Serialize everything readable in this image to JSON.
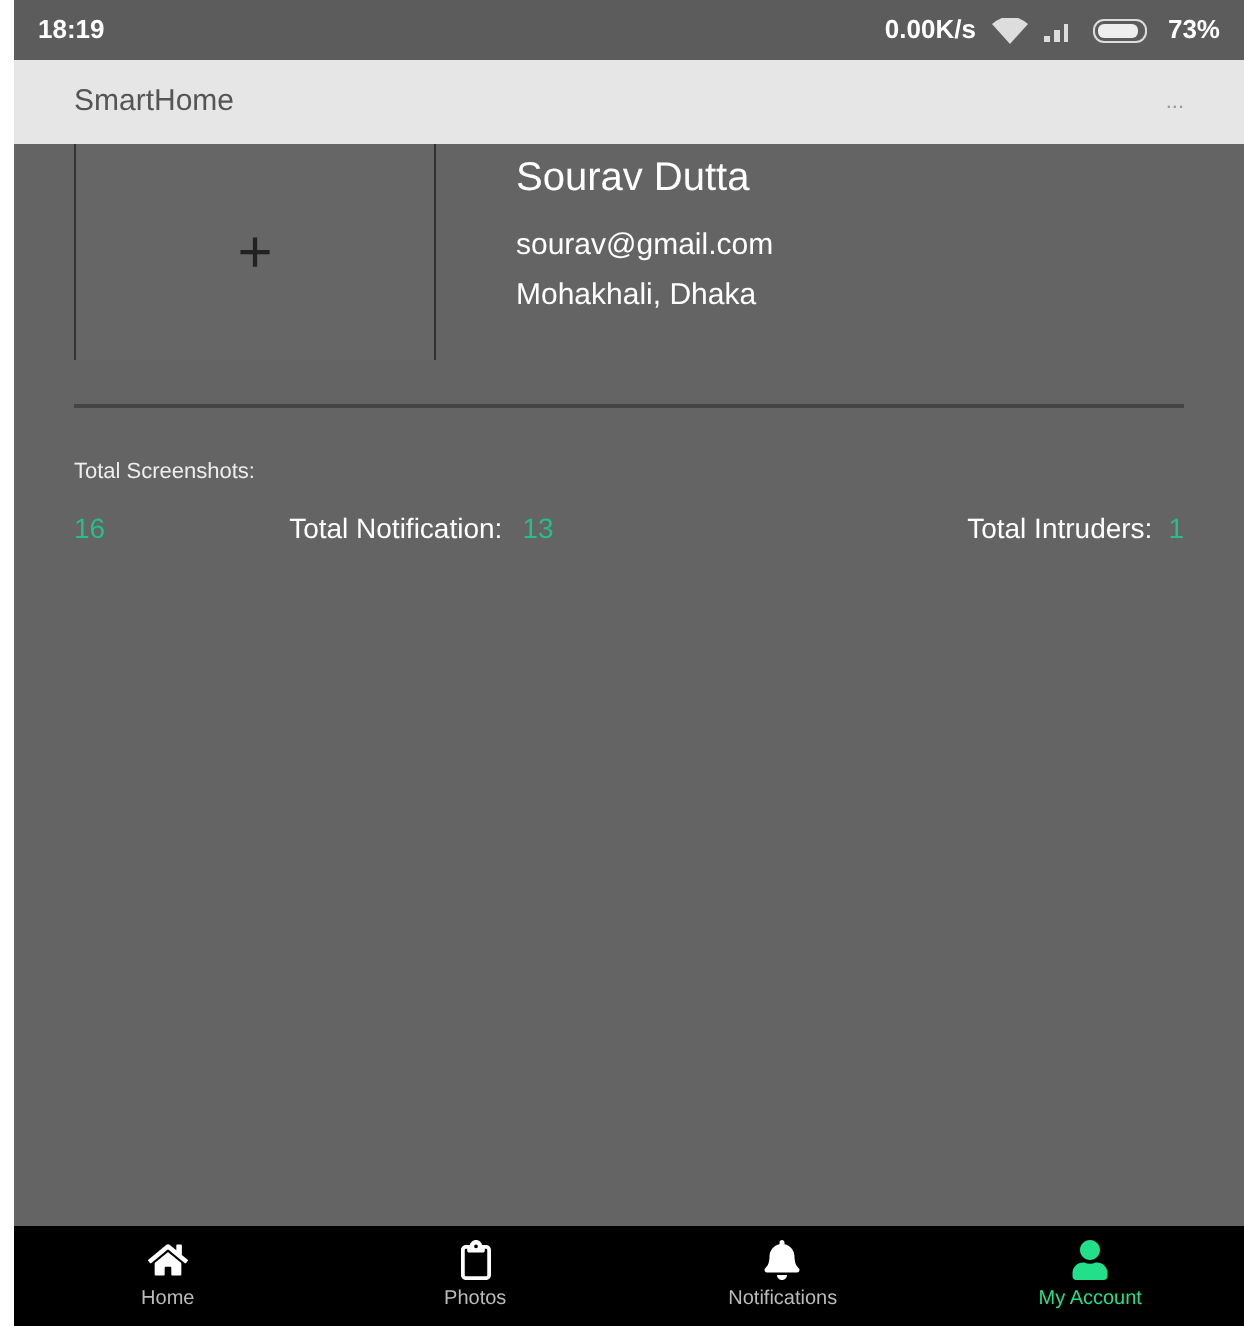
{
  "status_bar": {
    "time": "18:19",
    "speed": "0.00K/s",
    "battery": "73%"
  },
  "app_bar": {
    "title": "SmartHome",
    "menu": "..."
  },
  "profile": {
    "photo_button": "+",
    "name": "Sourav Dutta",
    "email": "sourav@gmail.com",
    "location": "Mohakhali, Dhaka"
  },
  "stats": {
    "screenshots_label": "Total Screenshots:",
    "screenshots_value": "16",
    "notification_label": "Total Notification:",
    "notification_value": "13",
    "intruders_label": "Total Intruders:",
    "intruders_value": "1"
  },
  "nav": [
    {
      "kind": "home",
      "label": "Home",
      "selected": false
    },
    {
      "kind": "photos",
      "label": "Photos",
      "selected": false
    },
    {
      "kind": "notifications",
      "label": "Notifications",
      "selected": false
    },
    {
      "kind": "account",
      "label": "My Account",
      "selected": true
    }
  ]
}
